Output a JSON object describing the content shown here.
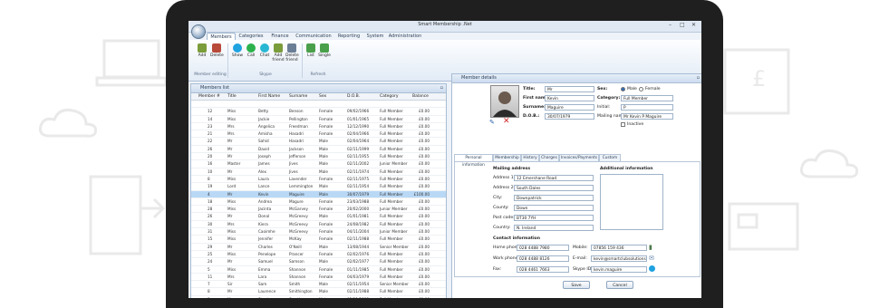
{
  "window": {
    "title": "Smart Membership .Net",
    "controls": [
      "–",
      "□",
      "✕"
    ]
  },
  "ribbon": {
    "tabs": [
      "Members",
      "Categories",
      "Finance",
      "Communication",
      "Reporting",
      "System",
      "Administration"
    ],
    "active_tab": "Members",
    "groups": [
      {
        "label": "Member editing",
        "buttons": [
          "Add",
          "Delete"
        ]
      },
      {
        "label": "Skype",
        "buttons": [
          "Show",
          "Call",
          "Chat",
          "Add friend",
          "Delete friend"
        ]
      },
      {
        "label": "Refresh",
        "buttons": [
          "List",
          "Single"
        ]
      }
    ]
  },
  "members_list": {
    "title": "Members list",
    "columns": [
      "Member #",
      "Title",
      "First Name",
      "Surname",
      "Sex",
      "D.O.B.",
      "Category",
      "Balance"
    ],
    "rows": [
      [
        "12",
        "Miss",
        "Betty",
        "Benson",
        "Female",
        "09/02/1966",
        "Full Member",
        "£0.00"
      ],
      [
        "14",
        "Miss",
        "Jackie",
        "Pellington",
        "Female",
        "01/01/1965",
        "Full Member",
        "£0.00"
      ],
      [
        "23",
        "Mrs",
        "Angelica",
        "Freedman",
        "Female",
        "12/12/1990",
        "Full Member",
        "£0.00"
      ],
      [
        "21",
        "Mrs",
        "Amisha",
        "Hasadri",
        "Female",
        "02/04/1966",
        "Full Member",
        "£0.00"
      ],
      [
        "22",
        "Mr",
        "Sahid",
        "Hasadri",
        "Male",
        "02/04/1964",
        "Full Member",
        "£0.00"
      ],
      [
        "26",
        "Mr",
        "David",
        "Jackson",
        "Male",
        "02/11/1999",
        "Full Member",
        "£0.00"
      ],
      [
        "20",
        "Mr",
        "Joseph",
        "Jefferson",
        "Male",
        "02/11/1955",
        "Full Member",
        "£0.00"
      ],
      [
        "16",
        "Master",
        "James",
        "Jives",
        "Male",
        "02/11/2002",
        "Junior Member",
        "£0.00"
      ],
      [
        "10",
        "Mr",
        "Alex",
        "Jives",
        "Male",
        "02/11/1974",
        "Full Member",
        "£0.00"
      ],
      [
        "8",
        "Miss",
        "Laura",
        "Lavender",
        "Female",
        "02/11/1975",
        "Full Member",
        "£0.00"
      ],
      [
        "19",
        "Lord",
        "Lance",
        "Lemmington",
        "Male",
        "02/11/1954",
        "Full Member",
        "£0.00"
      ],
      [
        "4",
        "Mr",
        "Kevin",
        "Maguire",
        "Male",
        "30/07/1979",
        "Full Member",
        "£100.00"
      ],
      [
        "18",
        "Miss",
        "Andrea",
        "Magure",
        "Female",
        "23/03/1988",
        "Full Member",
        "£0.00"
      ],
      [
        "28",
        "Miss",
        "Jacinta",
        "McGarvey",
        "Female",
        "20/02/2000",
        "Junior Member",
        "£0.00"
      ],
      [
        "26",
        "Mr",
        "Donal",
        "McGreevy",
        "Male",
        "01/01/1981",
        "Full Member",
        "£0.00"
      ],
      [
        "30",
        "Mrs",
        "Kiera",
        "McGreevy",
        "Female",
        "24/08/1982",
        "Full Member",
        "£0.00"
      ],
      [
        "31",
        "Miss",
        "Caoimhe",
        "McGreevy",
        "Female",
        "04/11/2004",
        "Junior Member",
        "£0.00"
      ],
      [
        "15",
        "Miss",
        "Jennifer",
        "McKay",
        "Female",
        "02/11/1988",
        "Full Member",
        "£0.00"
      ],
      [
        "29",
        "Mr",
        "Charles",
        "O'Neill",
        "Male",
        "13/08/1944",
        "Senior Member",
        "£0.00"
      ],
      [
        "25",
        "Miss",
        "Penelope",
        "Prancer",
        "Female",
        "02/02/1976",
        "Full Member",
        "£0.00"
      ],
      [
        "24",
        "Mr",
        "Samuel",
        "Samson",
        "Male",
        "02/02/1977",
        "Full Member",
        "£0.00"
      ],
      [
        "5",
        "Miss",
        "Emma",
        "Shannon",
        "Female",
        "01/11/1985",
        "Full Member",
        "£0.00"
      ],
      [
        "11",
        "Mrs",
        "Lara",
        "Shannon",
        "Female",
        "04/03/1979",
        "Full Member",
        "£0.00"
      ],
      [
        "7",
        "Sir",
        "Sam",
        "Smith",
        "Male",
        "02/11/1954",
        "Senior Member",
        "£0.00"
      ],
      [
        "8",
        "Mr",
        "Laurence",
        "Smithington",
        "Male",
        "02/11/1988",
        "Full Member",
        "£0.00"
      ],
      [
        "3",
        "Mr",
        "Stephen",
        "Smyth",
        "Male",
        "02/11/1983",
        "Full Member",
        "£0.00"
      ],
      [
        "13",
        "Miss",
        "Ingrid",
        "Spencer",
        "Female",
        "23/12/1969",
        "Full Member",
        "£0.00"
      ],
      [
        "27",
        "Mr",
        "Peter",
        "Venney",
        "Male",
        "01/01/1985",
        "Full Member",
        "£0.00"
      ]
    ],
    "selected_index": 11
  },
  "member_details": {
    "title": "Member details",
    "title_label": "Title:",
    "title_value": "Mr",
    "first_name_label": "First name:",
    "first_name": "Kevin",
    "surname_label": "Surname:",
    "surname": "Maguire",
    "dob_label": "D.O.B.:",
    "dob": "30/07/1979",
    "sex_label": "Sex:",
    "sex_options": [
      "Male",
      "Female"
    ],
    "sex_selected": "Male",
    "category_label": "Category:",
    "category": "Full Member",
    "initial_label": "Initial:",
    "initial": "P",
    "mailing_label": "Mailing name:",
    "mailing_name": "Mr Kevin P Maguire",
    "inactive_label": "Inactive",
    "tabs": [
      "Personal information",
      "Membership",
      "History",
      "Charges",
      "Invoices/Payments",
      "Custom"
    ],
    "active_tab": "Personal information",
    "mailing_address_heading": "Mailing address",
    "additional_info_heading": "Additional information",
    "address": [
      {
        "label": "Address 1:",
        "value": "12 Emershane Road"
      },
      {
        "label": "Address 2:",
        "value": "South Dales"
      },
      {
        "label": "City:",
        "value": "Downpatrick"
      },
      {
        "label": "County:",
        "value": "Down"
      },
      {
        "label": "Post code:",
        "value": "BT30 7YH"
      },
      {
        "label": "Country:",
        "value": "N. Ireland"
      }
    ],
    "contact_heading": "Contact information",
    "contacts_left": [
      {
        "label": "Home phone:",
        "value": "028 4488 7980"
      },
      {
        "label": "Work phone:",
        "value": "028 4488 8126"
      },
      {
        "label": "Fax:",
        "value": "028 4461 7663"
      }
    ],
    "contacts_right": [
      {
        "label": "Mobile:",
        "value": "07856 159 436"
      },
      {
        "label": "E-mail:",
        "value": "kevin@smartclubsolutions.com"
      },
      {
        "label": "Skype ID:",
        "value": "kevin.maguire"
      }
    ],
    "save_label": "Save",
    "cancel_label": "Cancel"
  },
  "colors": {
    "accent": "#2f6db5",
    "selected_row": "#b9d8f5",
    "device": "#1f1f1f"
  }
}
